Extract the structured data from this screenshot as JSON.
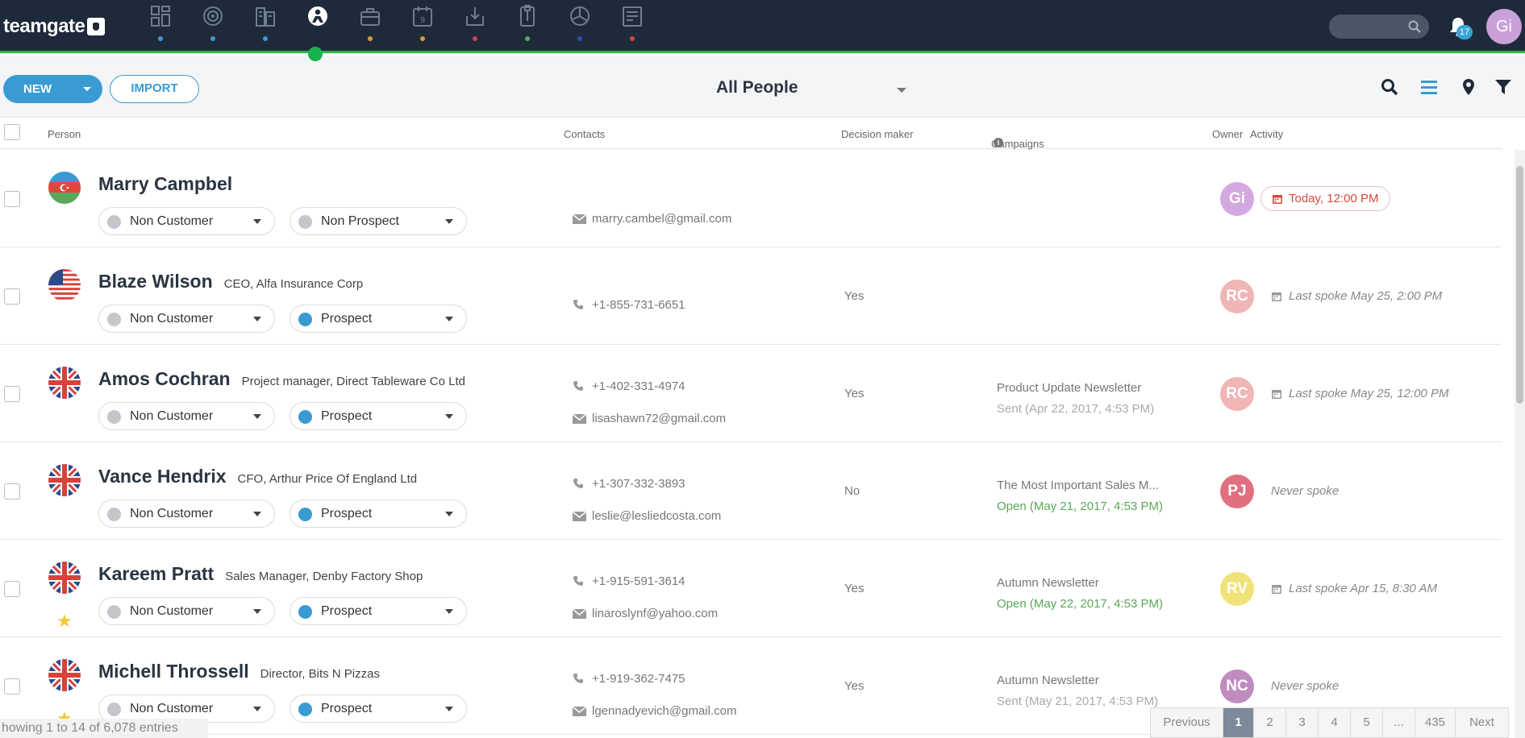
{
  "app": {
    "logo_text": "teamgate"
  },
  "nav": {
    "items": [
      {
        "icon": "dashboard-icon",
        "dot": "#3a9bd2"
      },
      {
        "icon": "target-icon",
        "dot": "#3a9bd2"
      },
      {
        "icon": "companies-icon",
        "dot": "#3a9bd2"
      },
      {
        "icon": "people-icon",
        "dot": "",
        "active": true
      },
      {
        "icon": "deals-icon",
        "dot": "#e0963a"
      },
      {
        "icon": "calendar-icon",
        "dot": "#e0963a"
      },
      {
        "icon": "inbox-icon",
        "dot": "#c8455a"
      },
      {
        "icon": "documents-icon",
        "dot": "#4cb15c"
      },
      {
        "icon": "reports-icon",
        "dot": "#2a4fb0"
      },
      {
        "icon": "invoices-icon",
        "dot": "#d9413a"
      }
    ],
    "notifications_count": "17",
    "user_initials": "Gi"
  },
  "toolbar": {
    "new_label": "NEW",
    "import_label": "IMPORT",
    "view_label": "All People"
  },
  "columns": {
    "person": "Person",
    "contacts": "Contacts",
    "decision": "Decision maker",
    "campaigns": "Campaigns",
    "owner": "Owner",
    "activity": "Activity"
  },
  "people": [
    {
      "name": "Marry Campbel",
      "title": "",
      "flag": "az",
      "starred": false,
      "customer": "Non Customer",
      "customer_color": "#c3c6cb",
      "prospect": "Non Prospect",
      "prospect_color": "#c3c6cb",
      "phone": "",
      "email": "marry.cambel@gmail.com",
      "decision": "",
      "campaign": "",
      "campaign_status": "",
      "campaign_status_color": "",
      "owner": "Gi",
      "owner_color": "#d4a8e0",
      "activity": "Today, 12:00 PM",
      "activity_today": true
    },
    {
      "name": "Blaze Wilson",
      "title": "CEO, Alfa Insurance Corp",
      "flag": "us",
      "starred": false,
      "customer": "Non Customer",
      "customer_color": "#c3c6cb",
      "prospect": "Prospect",
      "prospect_color": "#3a9bd2",
      "phone": "+1-855-731-6651",
      "email": "",
      "decision": "Yes",
      "campaign": "",
      "campaign_status": "",
      "campaign_status_color": "",
      "owner": "RC",
      "owner_color": "#f0b5b5",
      "activity": "Last spoke May 25, 2:00 PM",
      "activity_today": false
    },
    {
      "name": "Amos Cochran",
      "title": "Project manager, Direct Tableware Co Ltd",
      "flag": "gb",
      "starred": false,
      "customer": "Non Customer",
      "customer_color": "#c3c6cb",
      "prospect": "Prospect",
      "prospect_color": "#3a9bd2",
      "phone": "+1-402-331-4974",
      "email": "lisashawn72@gmail.com",
      "decision": "Yes",
      "campaign": "Product Update Newsletter",
      "campaign_status": "Sent (Apr 22, 2017, 4:53 PM)",
      "campaign_status_color": "#aaaaaa",
      "owner": "RC",
      "owner_color": "#f0b5b5",
      "activity": "Last spoke May 25, 12:00 PM",
      "activity_today": false
    },
    {
      "name": "Vance Hendrix",
      "title": "CFO, Arthur Price Of England Ltd",
      "flag": "gb",
      "starred": false,
      "customer": "Non Customer",
      "customer_color": "#c3c6cb",
      "prospect": "Prospect",
      "prospect_color": "#3a9bd2",
      "phone": "+1-307-332-3893",
      "email": "leslie@lesliedcosta.com",
      "decision": "No",
      "campaign": "The Most Important Sales M...",
      "campaign_status": "Open (May 21, 2017, 4:53 PM)",
      "campaign_status_color": "#5aa85a",
      "owner": "PJ",
      "owner_color": "#e06f80",
      "activity": "Never spoke",
      "activity_today": false
    },
    {
      "name": "Kareem Pratt",
      "title": "Sales Manager, Denby Factory Shop",
      "flag": "gb",
      "starred": true,
      "customer": "Non Customer",
      "customer_color": "#c3c6cb",
      "prospect": "Prospect",
      "prospect_color": "#3a9bd2",
      "phone": "+1-915-591-3614",
      "email": "linaroslynf@yahoo.com",
      "decision": "Yes",
      "campaign": "Autumn Newsletter",
      "campaign_status": "Open (May 22, 2017, 4:53 PM)",
      "campaign_status_color": "#5aa85a",
      "owner": "RV",
      "owner_color": "#f2e27a",
      "activity": "Last spoke Apr 15, 8:30 AM",
      "activity_today": false
    },
    {
      "name": "Michell Throssell",
      "title": "Director, Bits N Pizzas",
      "flag": "gb",
      "starred": true,
      "customer": "Non Customer",
      "customer_color": "#c3c6cb",
      "prospect": "Prospect",
      "prospect_color": "#3a9bd2",
      "phone": "+1-919-362-7475",
      "email": "lgennadyevich@gmail.com",
      "decision": "Yes",
      "campaign": "Autumn Newsletter",
      "campaign_status": "Sent (May 21, 2017, 4:53 PM)",
      "campaign_status_color": "#aaaaaa",
      "owner": "NC",
      "owner_color": "#c08cc0",
      "activity": "Never spoke",
      "activity_today": false
    }
  ],
  "footer": {
    "entries_text": "howing 1 to 14 of 6,078 entries",
    "pager": [
      "Previous",
      "1",
      "2",
      "3",
      "4",
      "5",
      "...",
      "435",
      "Next"
    ],
    "current_page": "1"
  }
}
